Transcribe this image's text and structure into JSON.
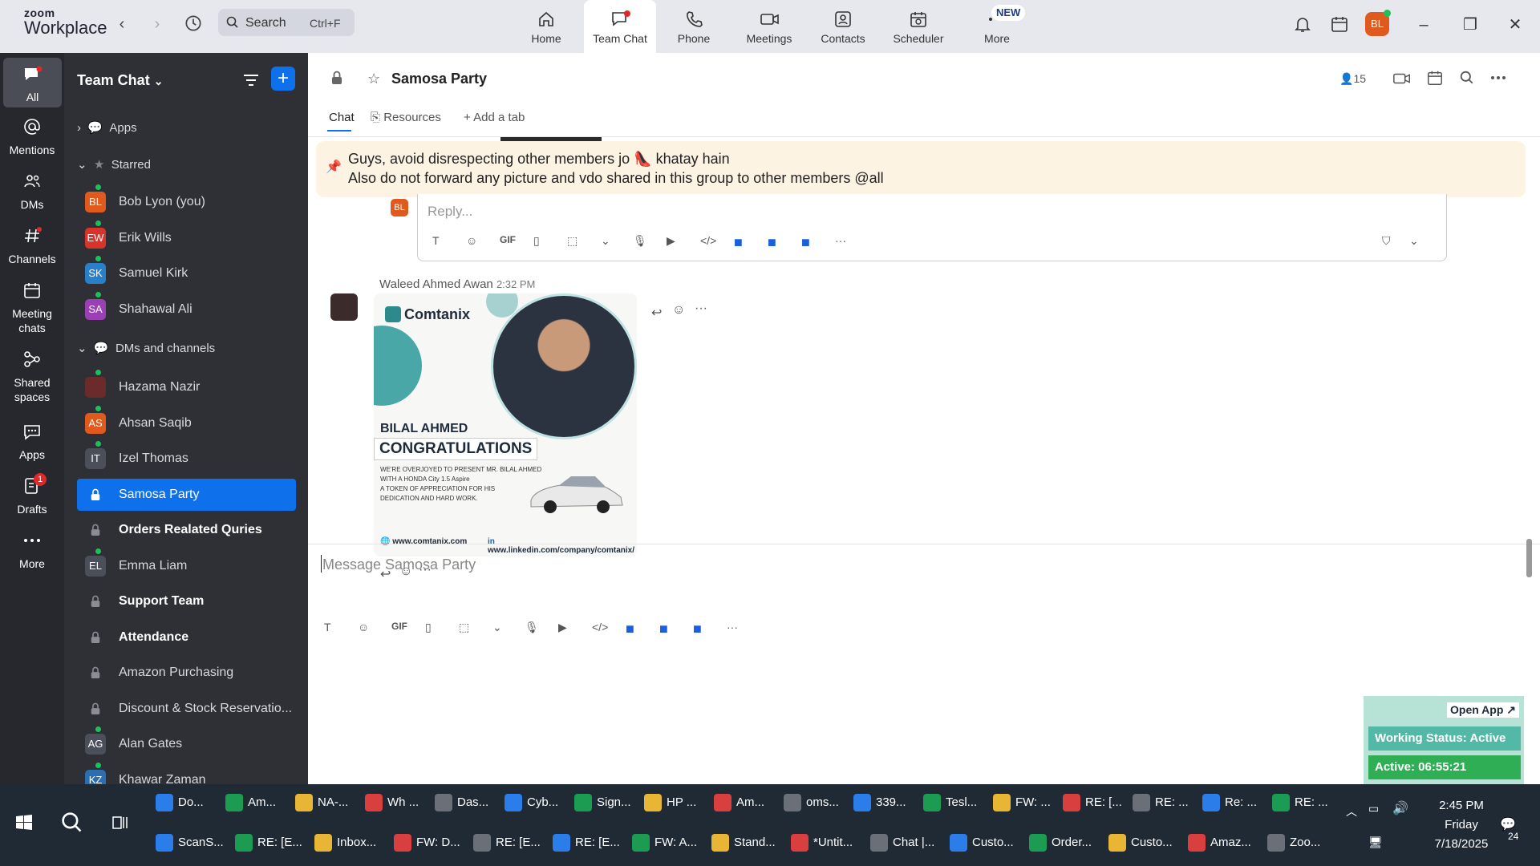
{
  "app": {
    "brand_top": "zoom",
    "brand_bottom": "Workplace"
  },
  "topbar": {
    "search_label": "Search",
    "search_shortcut": "Ctrl+F",
    "nav": [
      {
        "label": "Home"
      },
      {
        "label": "Team Chat"
      },
      {
        "label": "Phone"
      },
      {
        "label": "Meetings"
      },
      {
        "label": "Contacts"
      },
      {
        "label": "Scheduler"
      },
      {
        "label": "More"
      }
    ],
    "new_badge": "NEW",
    "avatar": "BL"
  },
  "rail": {
    "items": [
      {
        "label": "All"
      },
      {
        "label": "Mentions"
      },
      {
        "label": "DMs"
      },
      {
        "label": "Channels"
      },
      {
        "label": "Meeting chats"
      },
      {
        "label": "Shared spaces"
      },
      {
        "label": "Apps"
      },
      {
        "label": "Drafts",
        "badge": "1"
      },
      {
        "label": "More"
      }
    ]
  },
  "sidebar": {
    "title": "Team Chat",
    "sections": {
      "apps": "Apps",
      "starred": "Starred",
      "dms": "DMs and channels"
    },
    "starred": [
      {
        "initials": "BL",
        "name": "Bob Lyon (you)",
        "color": "#e05a1e"
      },
      {
        "initials": "EW",
        "name": "Erik Wills",
        "color": "#d9342b"
      },
      {
        "initials": "SK",
        "name": "Samuel Kirk",
        "color": "#2a7fc9"
      },
      {
        "initials": "SA",
        "name": "Shahawal Ali",
        "color": "#9b3fb5"
      }
    ],
    "channels": [
      {
        "initials": "",
        "name": "Hazama Nazir",
        "color": "#6b2b2b",
        "bold": false
      },
      {
        "initials": "AS",
        "name": "Ahsan Saqib",
        "color": "#e05a1e",
        "bold": false
      },
      {
        "initials": "IT",
        "name": "Izel Thomas",
        "color": "#4a4f5a",
        "bold": false
      },
      {
        "initials": "",
        "name": "Samosa Party",
        "color": "",
        "bold": false,
        "locked": true,
        "active": true
      },
      {
        "initials": "",
        "name": "Orders Realated Quries",
        "color": "",
        "bold": true,
        "locked": true
      },
      {
        "initials": "EL",
        "name": "Emma Liam",
        "color": "#4a4f5a",
        "bold": false
      },
      {
        "initials": "",
        "name": "Support Team",
        "color": "",
        "bold": true,
        "locked": true
      },
      {
        "initials": "",
        "name": "Attendance",
        "color": "",
        "bold": true,
        "locked": true
      },
      {
        "initials": "",
        "name": "Amazon Purchasing",
        "color": "",
        "bold": false,
        "locked": true
      },
      {
        "initials": "",
        "name": "Discount & Stock Reservatio...",
        "color": "",
        "bold": false,
        "locked": true
      },
      {
        "initials": "AG",
        "name": "Alan Gates",
        "color": "#4a4f5a",
        "bold": false
      },
      {
        "initials": "KZ",
        "name": "Khawar Zaman",
        "color": "#2a6fb0",
        "bold": false
      }
    ]
  },
  "channel": {
    "name": "Samosa Party",
    "member_count": "15",
    "tabs": {
      "chat": "Chat",
      "resources": "Resources",
      "add": "Add a tab"
    },
    "pinned_line1": "Guys, avoid disrespecting other members jo 👠 khatay hain",
    "pinned_line2": "Also do not forward any picture and vdo shared in this group to other members @all",
    "reply_placeholder": "Reply...",
    "reply_avatar": "BL",
    "message": {
      "author": "Waleed Ahmed Awan",
      "time": "2:32 PM"
    },
    "card": {
      "brand": "Comtanix",
      "name": "BILAL AHMED",
      "headline": "CONGRATULATIONS",
      "body1": "WE'RE OVERJOYED TO PRESENT MR. BILAL AHMED",
      "body2": "WITH A HONDA City 1.5 Aspire",
      "body3": "A TOKEN OF APPRECIATION FOR HIS",
      "body4": "DEDICATION AND HARD WORK.",
      "site": "www.comtanix.com",
      "linkedin": "www.linkedin.com/company/comtanix/"
    },
    "composer_placeholder": "Message Samosa Party",
    "gif": "GIF"
  },
  "widget": {
    "open_app": "Open App ↗",
    "working_status": "Working Status: Active",
    "active_timer": "Active: 06:55:21"
  },
  "taskbar": {
    "row1": [
      "Do...",
      "Am...",
      "NA-...",
      "Wh ...",
      "Das...",
      "Cyb...",
      "Sign...",
      "HP ...",
      "Am...",
      "oms...",
      "339...",
      "Tesl...",
      "FW: ...",
      "RE: [...",
      "RE: ...",
      "Re: ...",
      "RE: ..."
    ],
    "row2": [
      "ScanS...",
      "RE: [E...",
      "Inbox...",
      "FW: D...",
      "RE: [E...",
      "RE: [E...",
      "FW: A...",
      "Stand...",
      "*Untit...",
      "Chat |...",
      "Custo...",
      "Order...",
      "Custo...",
      "Amaz...",
      "Zoo..."
    ],
    "time": "2:45 PM",
    "day": "Friday",
    "date": "7/18/2025",
    "notif": "24"
  }
}
